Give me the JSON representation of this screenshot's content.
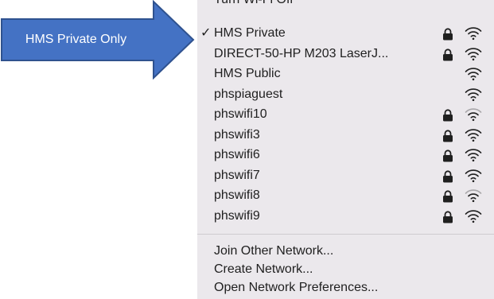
{
  "callout": {
    "label": "HMS Private Only",
    "fill_color": "#4472c4",
    "border_color": "#2f528f"
  },
  "menu": {
    "top_item_label": "Turn Wi-Fi Off",
    "networks": [
      {
        "name": "HMS Private",
        "connected": true,
        "check": "✓",
        "locked": true,
        "signal": "full"
      },
      {
        "name": "DIRECT-50-HP M203 LaserJ...",
        "connected": false,
        "check": "",
        "locked": true,
        "signal": "full"
      },
      {
        "name": "HMS Public",
        "connected": false,
        "check": "",
        "locked": false,
        "signal": "full"
      },
      {
        "name": "phspiaguest",
        "connected": false,
        "check": "",
        "locked": false,
        "signal": "full"
      },
      {
        "name": "phswifi10",
        "connected": false,
        "check": "",
        "locked": true,
        "signal": "weak"
      },
      {
        "name": "phswifi3",
        "connected": false,
        "check": "",
        "locked": true,
        "signal": "full"
      },
      {
        "name": "phswifi6",
        "connected": false,
        "check": "",
        "locked": true,
        "signal": "full"
      },
      {
        "name": "phswifi7",
        "connected": false,
        "check": "",
        "locked": true,
        "signal": "full"
      },
      {
        "name": "phswifi8",
        "connected": false,
        "check": "",
        "locked": true,
        "signal": "weak"
      },
      {
        "name": "phswifi9",
        "connected": false,
        "check": "",
        "locked": true,
        "signal": "full"
      }
    ],
    "actions": [
      {
        "label": "Join Other Network..."
      },
      {
        "label": "Create Network..."
      },
      {
        "label": "Open Network Preferences..."
      }
    ],
    "icons": {
      "lock": "lock-icon",
      "wifi": "wifi-icon",
      "check": "checkmark-icon"
    },
    "colors": {
      "background": "#ebe8ec",
      "text": "#1f1f1f",
      "icon_full": "#1f1f1f",
      "icon_dim": "#a9a7aa"
    }
  }
}
